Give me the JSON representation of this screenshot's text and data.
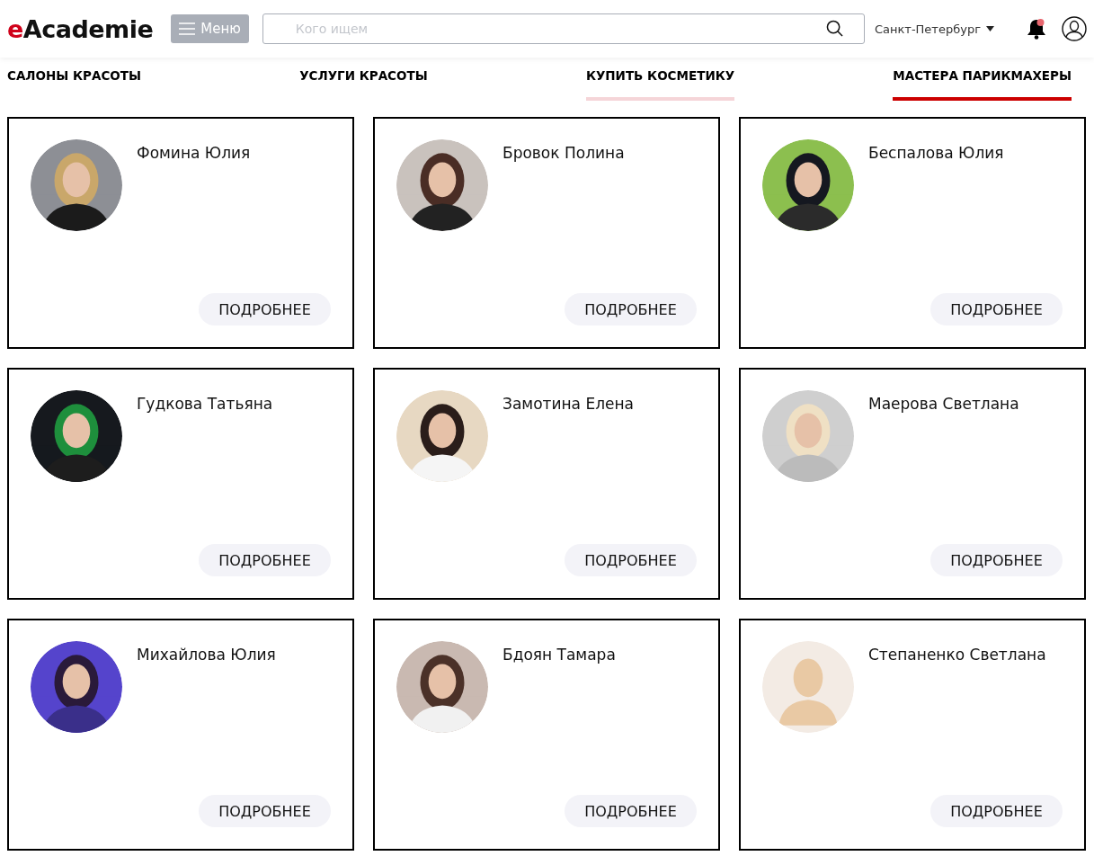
{
  "header": {
    "logo": {
      "accent": "e",
      "rest": "Academie"
    },
    "menu_button": "Меню",
    "search": {
      "placeholder": "Кого ищем"
    },
    "city": "Санкт-Петербург",
    "notifications": {
      "unread": true
    }
  },
  "tabs": [
    {
      "label": "САЛОНЫ КРАСОТЫ",
      "selected": false,
      "hovered": false
    },
    {
      "label": "УСЛУГИ КРАСОТЫ",
      "selected": false,
      "hovered": false
    },
    {
      "label": "КУПИТЬ КОСМЕТИКУ",
      "selected": false,
      "hovered": true
    },
    {
      "label": "МАСТЕРА ПАРИКМАХЕРЫ",
      "selected": true,
      "hovered": false
    }
  ],
  "masters": [
    {
      "name": "Фомина Юлия",
      "button": "ПОДРОБНЕЕ"
    },
    {
      "name": "Бровок Полина",
      "button": "ПОДРОБНЕЕ"
    },
    {
      "name": "Беспалова Юлия",
      "button": "ПОДРОБНЕЕ"
    },
    {
      "name": "Гудкова Татьяна",
      "button": "ПОДРОБНЕЕ"
    },
    {
      "name": "Замотина Елена",
      "button": "ПОДРОБНЕЕ"
    },
    {
      "name": "Маерова Светлана",
      "button": "ПОДРОБНЕЕ"
    },
    {
      "name": "Михайлова Юлия",
      "button": "ПОДРОБНЕЕ"
    },
    {
      "name": "Бдоян Тамара",
      "button": "ПОДРОБНЕЕ"
    },
    {
      "name": "Степаненко Светлана",
      "kind": "placeholder",
      "button": "ПОДРОБНЕЕ"
    }
  ]
}
